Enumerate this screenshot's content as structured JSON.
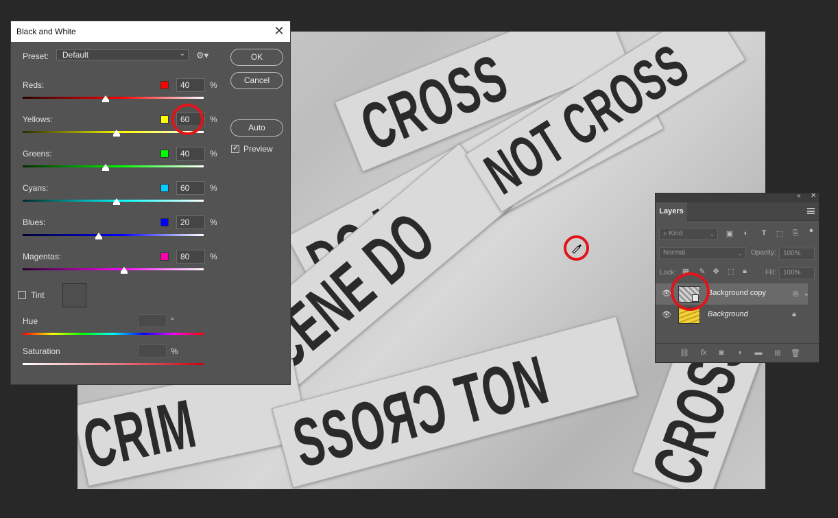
{
  "dialog": {
    "title": "Black and White",
    "preset_label": "Preset:",
    "preset_value": "Default",
    "ok_label": "OK",
    "cancel_label": "Cancel",
    "auto_label": "Auto",
    "preview_label": "Preview",
    "preview_checked": true,
    "percent_symbol": "%",
    "degree_symbol": "°",
    "sliders": [
      {
        "label": "Reds",
        "value": "40",
        "swatch": "#ff0000",
        "level": 0.46
      },
      {
        "label": "Yellows",
        "value": "60",
        "swatch": "#ffff00",
        "level": 0.52
      },
      {
        "label": "Greens",
        "value": "40",
        "swatch": "#00ff00",
        "level": 0.46
      },
      {
        "label": "Cyans",
        "value": "60",
        "swatch": "#00ccff",
        "level": 0.52
      },
      {
        "label": "Blues",
        "value": "20",
        "swatch": "#0000ff",
        "level": 0.42
      },
      {
        "label": "Magentas",
        "value": "80",
        "swatch": "#ff00aa",
        "level": 0.56
      }
    ],
    "tint_label": "Tint",
    "tint_checked": false,
    "hue_label": "Hue",
    "saturation_label": "Saturation"
  },
  "canvas": {
    "tape_texts": [
      "CRIME SCENE DO NOT CROSS",
      "NOT CROSS",
      "CROSS",
      "SCENE DO",
      "DO NOT CROSS",
      "CRIM",
      "SSOЯƆ TON",
      "CROSS"
    ]
  },
  "layers": {
    "tab_label": "Layers",
    "filter_kind": "Kind",
    "blend_mode": "Normal",
    "opacity_label": "Opacity:",
    "opacity_value": "100%",
    "lock_label": "Lock:",
    "fill_label": "Fill:",
    "fill_value": "100%",
    "items": [
      {
        "name": "Background copy",
        "selected": true,
        "italic": false
      },
      {
        "name": "Background",
        "selected": false,
        "italic": true
      }
    ]
  },
  "colors": {
    "annotation_red": "#e0141a",
    "dialog_bg": "#535353",
    "workspace_bg": "#282828"
  }
}
